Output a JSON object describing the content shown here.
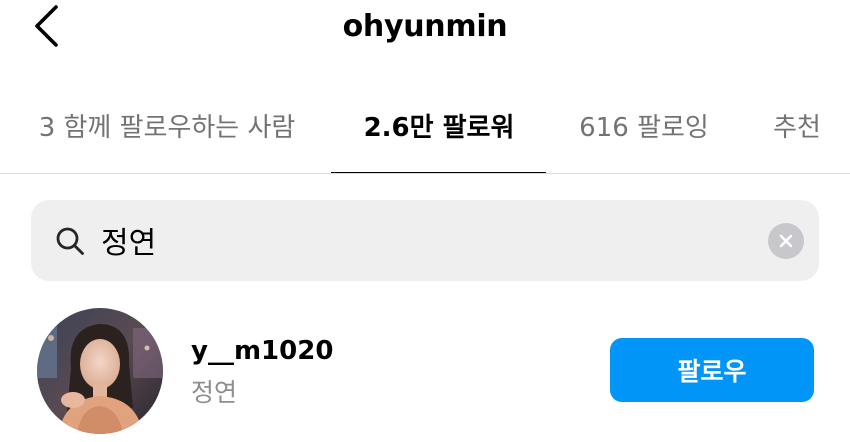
{
  "header": {
    "title": "ohyunmin",
    "back_icon": "chevron-left-icon"
  },
  "tabs": [
    {
      "label": "3 함께 팔로우하는 사람",
      "active": false
    },
    {
      "label": "2.6만 팔로워",
      "active": true
    },
    {
      "label": "616 팔로잉",
      "active": false
    },
    {
      "label": "추천",
      "active": false
    }
  ],
  "search": {
    "value": "정연",
    "icon": "search-icon",
    "clear_icon": "clear-icon"
  },
  "results": [
    {
      "username": "y__m1020",
      "full_name": "정연",
      "button_label": "팔로우"
    }
  ],
  "colors": {
    "accent": "#0095f6",
    "secondary_text": "#8e8e8e",
    "inactive_tab": "#737373",
    "search_bg": "#efefef",
    "divider": "#dbdbdb"
  }
}
